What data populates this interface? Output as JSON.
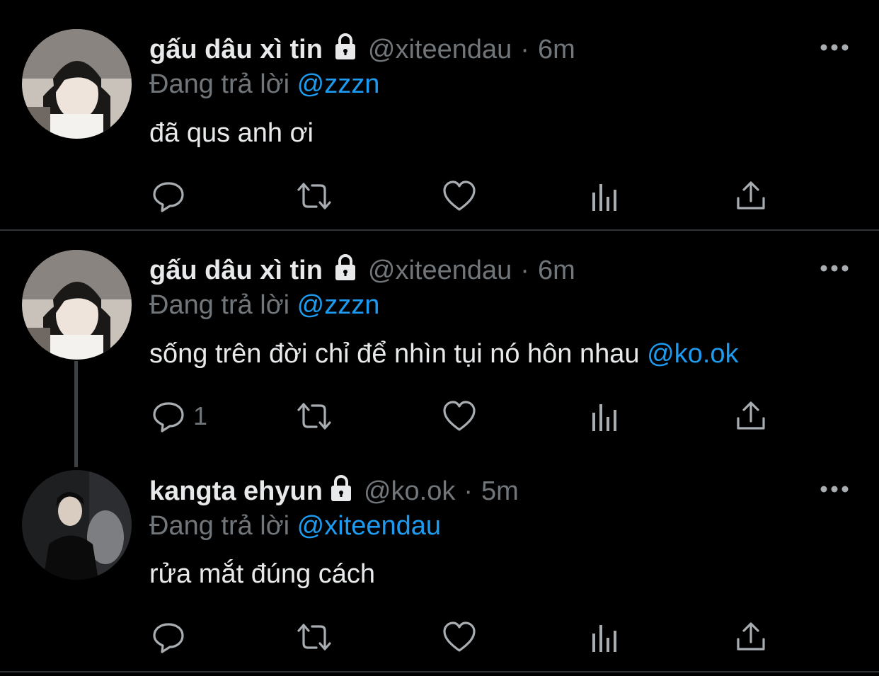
{
  "colors": {
    "background": "#000000",
    "text": "#e7e9ea",
    "muted": "#71767b",
    "accent": "#1d9bf0",
    "separator": "#2f3336"
  },
  "tweets": [
    {
      "display_name": "gấu dâu xì tin",
      "handle": "@xiteendau",
      "dot": "·",
      "time": "6m",
      "replying_prefix": "Đang trả lời",
      "replying_to": "@zzzn",
      "text": "đã qus anh ơi",
      "text_mention": "",
      "reply_count": "",
      "icons": [
        "lock-icon",
        "more-icon",
        "reply-icon",
        "retweet-icon",
        "like-icon",
        "analytics-icon",
        "share-icon"
      ]
    },
    {
      "display_name": "gấu dâu xì tin",
      "handle": "@xiteendau",
      "dot": "·",
      "time": "6m",
      "replying_prefix": "Đang trả lời",
      "replying_to": "@zzzn",
      "text": "sống trên đời chỉ để nhìn tụi nó hôn nhau",
      "text_mention": "@ko.ok",
      "reply_count": "1",
      "icons": [
        "lock-icon",
        "more-icon",
        "reply-icon",
        "retweet-icon",
        "like-icon",
        "analytics-icon",
        "share-icon"
      ]
    },
    {
      "display_name": "kangta ehyun",
      "handle": "@ko.ok",
      "dot": "·",
      "time": "5m",
      "replying_prefix": "Đang trả lời",
      "replying_to": "@xiteendau",
      "text": "rửa mắt đúng cách",
      "text_mention": "",
      "reply_count": "",
      "icons": [
        "lock-icon",
        "more-icon",
        "reply-icon",
        "retweet-icon",
        "like-icon",
        "analytics-icon",
        "share-icon"
      ]
    }
  ]
}
